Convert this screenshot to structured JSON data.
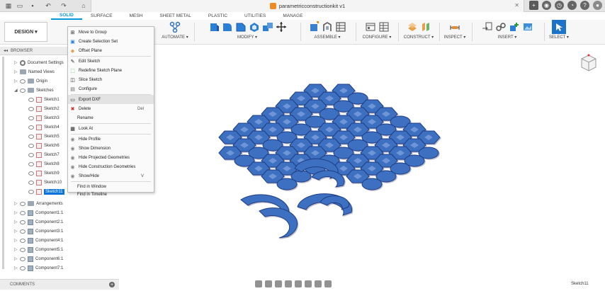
{
  "window": {
    "title": "parametricconstructionkit v1"
  },
  "tabs": [
    "SOLID",
    "SURFACE",
    "MESH",
    "SHEET METAL",
    "PLASTIC",
    "UTILITIES",
    "MANAGE"
  ],
  "active_tab": "SOLID",
  "toolbar": {
    "workspace": "DESIGN ▾",
    "groups": [
      "AUTOMATE ▾",
      "MODIFY ▾",
      "ASSEMBLE ▾",
      "CONFIGURE ▾",
      "CONSTRUCT ▾",
      "INSPECT ▾",
      "INSERT ▾",
      "SELECT ▾"
    ]
  },
  "browser": {
    "header": "BROWSER",
    "items": [
      "Document Settings",
      "Named Views",
      "Origin",
      "Sketches",
      "Sketch1",
      "Sketch2",
      "Sketch3",
      "Sketch4",
      "Sketch5",
      "Sketch6",
      "Sketch7",
      "Sketch8",
      "Sketch9",
      "Sketch10",
      "Sketch11",
      "Arrangements",
      "Component1:1",
      "Component2:1",
      "Component3:1",
      "Component4:1",
      "Component5:1",
      "Component6:1",
      "Component7:1"
    ]
  },
  "context_menu": {
    "items": [
      "Move to Group",
      "Create Selection Set",
      "Offset Plane",
      "Edit Sketch",
      "Redefine Sketch Plane",
      "Slice Sketch",
      "Configure",
      "Export DXF",
      "Delete",
      "Rename",
      "Look At",
      "Hide Profile",
      "Show Dimension",
      "Hide Projected Geometries",
      "Hide Construction Geometries",
      "Show/Hide",
      "Find in Window",
      "Find in Timeline"
    ],
    "shortcuts": {
      "delete": "Del",
      "show_hide": "V"
    }
  },
  "comments": {
    "label": "COMMENTS"
  },
  "status": {
    "active_sketch": "Sketch11"
  },
  "colors": {
    "accent": "#0696d7",
    "part_blue": "#3e6fc0",
    "part_edge": "#1e3e86",
    "selection": "#0a74da"
  }
}
